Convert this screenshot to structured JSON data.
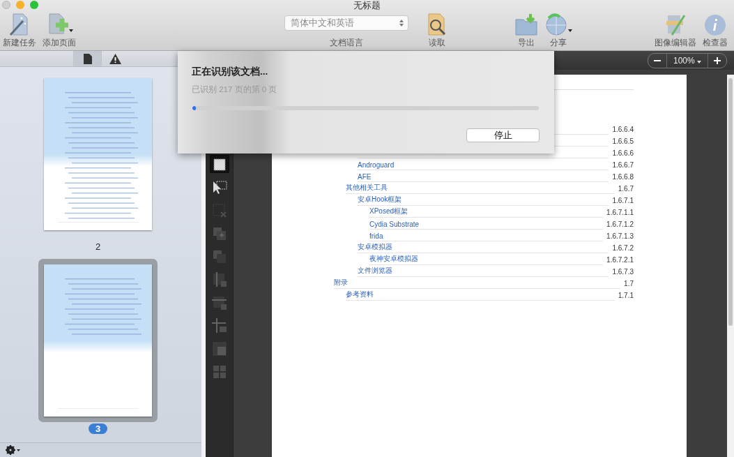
{
  "window": {
    "title": "无标题"
  },
  "toolbar": {
    "items": [
      {
        "kind": "new",
        "label": "新建任务"
      },
      {
        "kind": "add",
        "label": "添加页面"
      },
      {
        "kind": "language",
        "value": "简体中文和英语",
        "label": "文档语言"
      },
      {
        "kind": "read",
        "label": "读取"
      },
      {
        "kind": "export",
        "label": "导出"
      },
      {
        "kind": "share",
        "label": "分享"
      },
      {
        "kind": "spacer"
      },
      {
        "kind": "editor",
        "label": "图像编辑器"
      },
      {
        "kind": "inspector",
        "label": "检查器"
      }
    ]
  },
  "sidebar": {
    "tabs": [
      {
        "kind": "page",
        "selected": true
      },
      {
        "kind": "warning",
        "selected": false
      }
    ],
    "pages": [
      {
        "label": "2",
        "selected": false
      },
      {
        "label": "3",
        "selected": true
      }
    ]
  },
  "zoom": {
    "value": "100%"
  },
  "tools": [
    {
      "kind": "area",
      "selected": true,
      "disabled": false
    },
    {
      "kind": "select",
      "selected": false,
      "disabled": false
    },
    {
      "kind": "remove",
      "selected": false,
      "disabled": true
    },
    {
      "kind": "add",
      "selected": false,
      "disabled": true
    },
    {
      "kind": "subtract",
      "selected": false,
      "disabled": true
    },
    {
      "kind": "column",
      "selected": false,
      "disabled": true
    },
    {
      "kind": "row",
      "selected": false,
      "disabled": true
    },
    {
      "kind": "split",
      "selected": false,
      "disabled": true
    },
    {
      "kind": "cell",
      "selected": false,
      "disabled": true
    },
    {
      "kind": "table",
      "selected": false,
      "disabled": true
    }
  ],
  "document": {
    "toc": [
      {
        "children": [
          {
            "children": [
              {
                "number": "1.6.6.4"
              },
              {
                "number": "1.6.6.5"
              },
              {
                "number": "1.6.6.6"
              },
              {
                "title": "Androguard",
                "number": "1.6.6.7"
              },
              {
                "title": "AFE",
                "number": "1.6.6.8"
              }
            ]
          },
          {
            "title": "其他相关工具",
            "number": "1.6.7",
            "children": [
              {
                "title": "安卓Hook框架",
                "number": "1.6.7.1",
                "children": [
                  {
                    "title": "XPosed框架",
                    "number": "1.6.7.1.1"
                  },
                  {
                    "title": "Cydia Substrate",
                    "number": "1.6.7.1.2"
                  },
                  {
                    "title": "frida",
                    "number": "1.6.7.1.3"
                  }
                ]
              },
              {
                "title": "安卓模拟器",
                "number": "1.6.7.2",
                "children": [
                  {
                    "title": "夜神安卓模拟器",
                    "number": "1.6.7.2.1"
                  }
                ]
              },
              {
                "title": "文件浏览器",
                "number": "1.6.7.3"
              }
            ]
          }
        ]
      },
      {
        "title": "附录",
        "number": "1.7",
        "children": [
          {
            "title": "参考资料",
            "number": "1.7.1"
          }
        ]
      }
    ]
  },
  "dialog": {
    "title": "正在识别该文档...",
    "status": "已识别 217 页的第 0 页",
    "level": 0.01,
    "button": "停止"
  }
}
